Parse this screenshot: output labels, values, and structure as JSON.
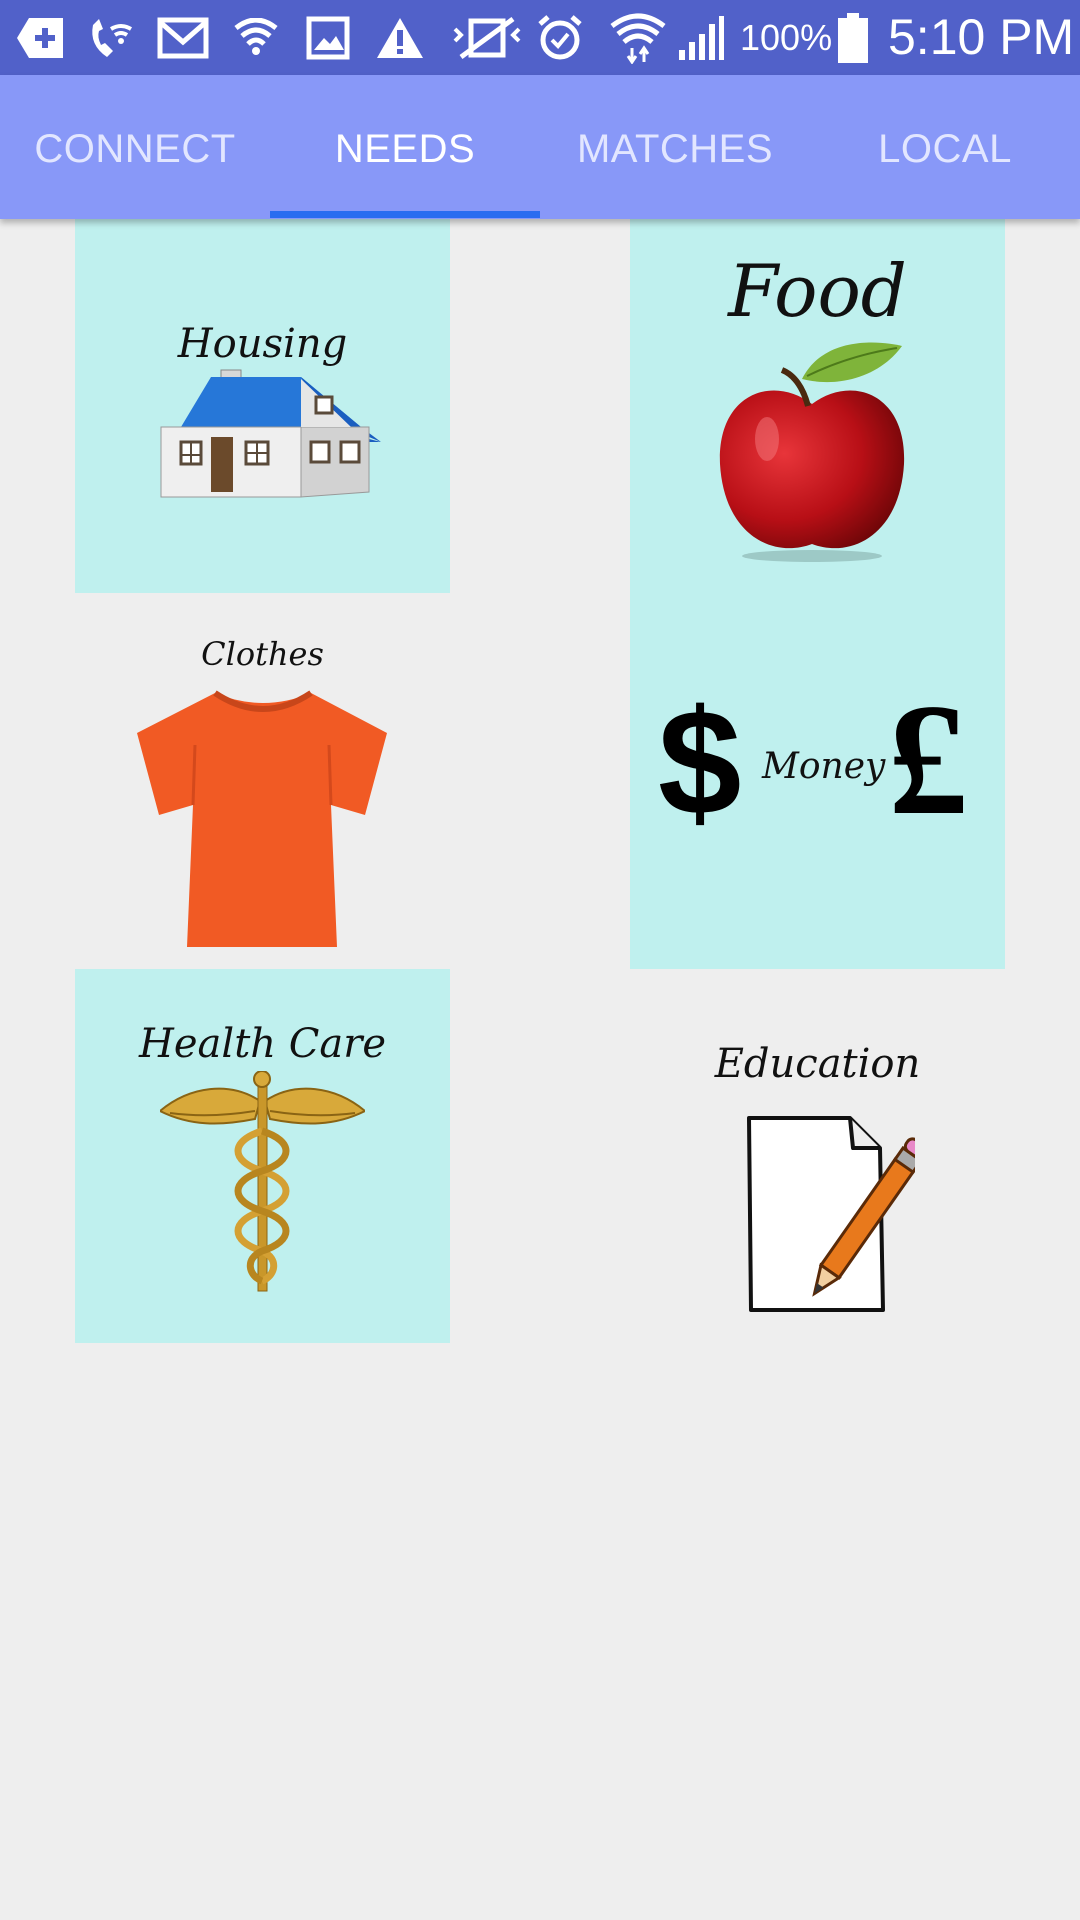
{
  "status_bar": {
    "battery": "100%",
    "time": "5:10 PM",
    "icons": [
      "add-icon",
      "wifi-call-icon",
      "gmail-icon",
      "vpn-icon",
      "image-icon",
      "warning-icon",
      "mute-icon",
      "alarm-icon",
      "wifi-icon",
      "signal-icon",
      "battery-icon"
    ]
  },
  "tabs": [
    {
      "label": "CONNECT"
    },
    {
      "label": "NEEDS"
    },
    {
      "label": "MATCHES"
    },
    {
      "label": "LOCAL"
    }
  ],
  "needs": {
    "housing": "Housing",
    "food": "Food",
    "clothes": "Clothes",
    "money": "Money",
    "health": "Health Care",
    "education": "Education"
  },
  "colors": {
    "status_bar": "#5161c9",
    "tab_bar": "#8898f8",
    "tab_indicator": "#2a6cf0",
    "tile": "#bff0ee",
    "background": "#eeeeee"
  }
}
